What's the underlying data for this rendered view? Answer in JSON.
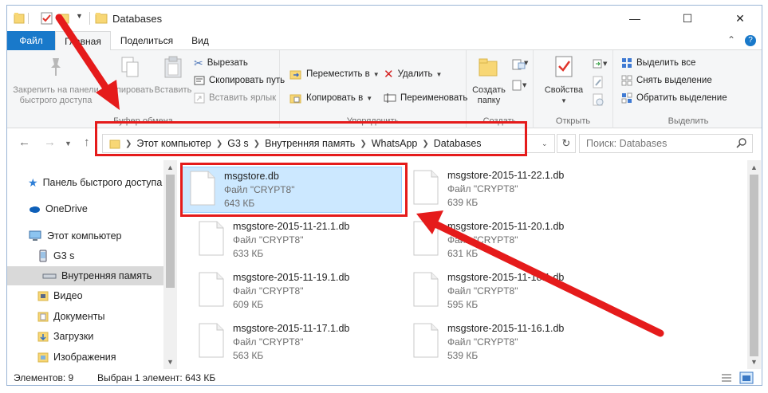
{
  "window": {
    "title": "Databases",
    "minimize_glyph": "—",
    "maximize_glyph": "☐",
    "close_glyph": "✕"
  },
  "ribbon_tabs": {
    "file": "Файл",
    "home": "Главная",
    "share": "Поделиться",
    "view": "Вид",
    "collapse_glyph": "⌃",
    "help_glyph": "?"
  },
  "ribbon": {
    "clipboard": {
      "pin": "Закрепить на панели быстрого доступа",
      "pin_line1": "Закрепить на панели",
      "pin_line2": "быстрого доступа",
      "copy": "Копировать",
      "paste": "Вставить",
      "cut": "Вырезать",
      "copy_path": "Скопировать путь",
      "paste_shortcut": "Вставить ярлык",
      "label": "Буфер обмена"
    },
    "organize": {
      "move_to": "Переместить в",
      "copy_to": "Копировать в",
      "delete": "Удалить",
      "rename": "Переименовать",
      "label": "Упорядочить"
    },
    "new": {
      "new_folder_line1": "Создать",
      "new_folder_line2": "папку",
      "label": "Создать"
    },
    "open": {
      "properties": "Свойства",
      "label": "Открыть"
    },
    "select": {
      "select_all": "Выделить все",
      "select_none": "Снять выделение",
      "invert": "Обратить выделение",
      "label": "Выделить"
    }
  },
  "address": {
    "crumbs": [
      "Этот компьютер",
      "G3 s",
      "Внутренняя память",
      "WhatsApp",
      "Databases"
    ],
    "search_placeholder": "Поиск: Databases"
  },
  "nav_pane": {
    "items": [
      {
        "label": "Панель быстрого доступа",
        "icon": "star-icon"
      },
      {
        "label": "OneDrive",
        "icon": "cloud-icon"
      },
      {
        "label": "Этот компьютер",
        "icon": "computer-icon"
      },
      {
        "label": "G3 s",
        "icon": "phone-icon"
      },
      {
        "label": "Внутренняя память",
        "icon": "drive-icon"
      },
      {
        "label": "Видео",
        "icon": "video-folder-icon"
      },
      {
        "label": "Документы",
        "icon": "documents-folder-icon"
      },
      {
        "label": "Загрузки",
        "icon": "downloads-folder-icon"
      },
      {
        "label": "Изображения",
        "icon": "pictures-folder-icon"
      }
    ]
  },
  "files": [
    {
      "name": "msgstore.db",
      "type": "Файл \"CRYPT8\"",
      "size": "643 КБ",
      "selected": true
    },
    {
      "name": "msgstore-2015-11-22.1.db",
      "type": "Файл \"CRYPT8\"",
      "size": "639 КБ"
    },
    {
      "name": "msgstore-2015-11-21.1.db",
      "type": "Файл \"CRYPT8\"",
      "size": "633 КБ"
    },
    {
      "name": "msgstore-2015-11-20.1.db",
      "type": "Файл \"CRYPT8\"",
      "size": "631 КБ"
    },
    {
      "name": "msgstore-2015-11-19.1.db",
      "type": "Файл \"CRYPT8\"",
      "size": "609 КБ"
    },
    {
      "name": "msgstore-2015-11-18.1.db",
      "type": "Файл \"CRYPT8\"",
      "size": "595 КБ"
    },
    {
      "name": "msgstore-2015-11-17.1.db",
      "type": "Файл \"CRYPT8\"",
      "size": "563 КБ"
    },
    {
      "name": "msgstore-2015-11-16.1.db",
      "type": "Файл \"CRYPT8\"",
      "size": "539 КБ"
    }
  ],
  "status": {
    "count": "Элементов: 9",
    "selection": "Выбран 1 элемент: 643 КБ"
  },
  "colors": {
    "accent": "#1979ca",
    "selection": "#cce8ff",
    "annotation": "#e51b1b"
  }
}
